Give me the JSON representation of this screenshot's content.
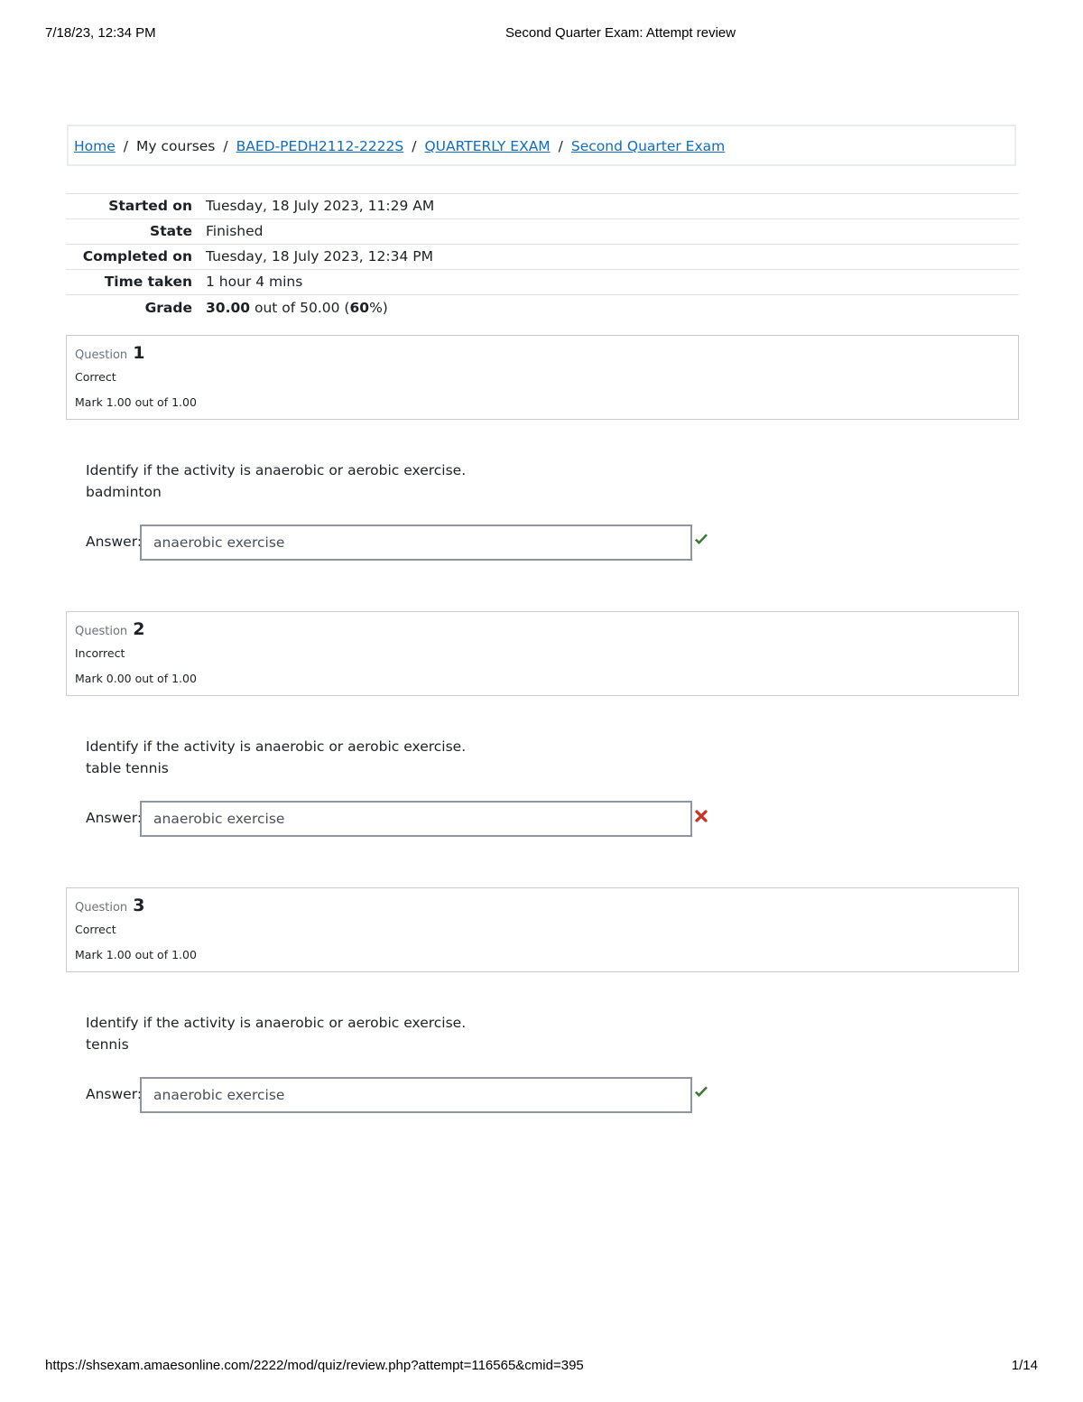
{
  "print_header": {
    "date": "7/18/23, 12:34 PM",
    "title": "Second Quarter Exam: Attempt review"
  },
  "breadcrumb": {
    "items": [
      {
        "label": "Home",
        "link": true
      },
      {
        "label": "My courses",
        "link": false
      },
      {
        "label": "BAED-PEDH2112-2222S",
        "link": true
      },
      {
        "label": "QUARTERLY EXAM",
        "link": true
      },
      {
        "label": "Second Quarter Exam",
        "link": true
      }
    ],
    "separator": "/"
  },
  "summary": {
    "rows": [
      {
        "label": "Started on",
        "value": "Tuesday, 18 July 2023, 11:29 AM"
      },
      {
        "label": "State",
        "value": "Finished"
      },
      {
        "label": "Completed on",
        "value": "Tuesday, 18 July 2023, 12:34 PM"
      },
      {
        "label": "Time taken",
        "value": "1 hour 4 mins"
      }
    ],
    "grade": {
      "label": "Grade",
      "score": "30.00",
      "out_of_text": " out of 50.00 (",
      "percent": "60",
      "percent_suffix": "%)"
    }
  },
  "questions": [
    {
      "prefix": "Question",
      "number": "1",
      "state": "Correct",
      "mark": "Mark 1.00 out of 1.00",
      "text": "Identify if the activity is anaerobic or aerobic exercise.",
      "activity": "badminton",
      "answer_label": "Answer:",
      "answer_value": "anaerobic exercise",
      "result_icon": "check-icon",
      "result_color": "#357a32"
    },
    {
      "prefix": "Question",
      "number": "2",
      "state": "Incorrect",
      "mark": "Mark 0.00 out of 1.00",
      "text": "Identify if the activity is anaerobic or aerobic exercise.",
      "activity": "table tennis",
      "answer_label": "Answer:",
      "answer_value": "anaerobic exercise",
      "result_icon": "cross-icon",
      "result_color": "#ca3120"
    },
    {
      "prefix": "Question",
      "number": "3",
      "state": "Correct",
      "mark": "Mark 1.00 out of 1.00",
      "text": "Identify if the activity is anaerobic or aerobic exercise.",
      "activity": "tennis",
      "answer_label": "Answer:",
      "answer_value": "anaerobic exercise",
      "result_icon": "check-icon",
      "result_color": "#357a32"
    }
  ],
  "print_footer": {
    "url": "https://shsexam.amaesonline.com/2222/mod/quiz/review.php?attempt=116565&cmid=395",
    "page": "1/14"
  },
  "colors": {
    "link": "#0f6cbf",
    "correct": "#357a32",
    "incorrect": "#ca3120"
  }
}
